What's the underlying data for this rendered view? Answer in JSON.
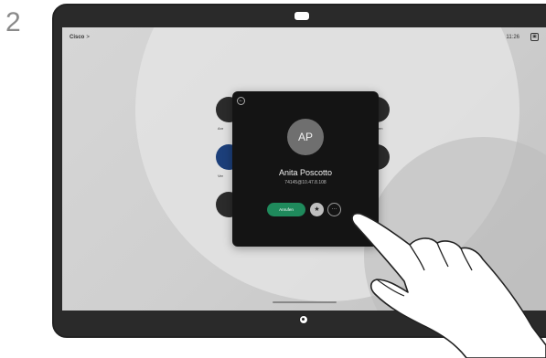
{
  "step": {
    "number": "2"
  },
  "header": {
    "brand": "Cisco",
    "chevron": ">",
    "time": "11:26"
  },
  "background_tiles": {
    "labels": [
      "Anr",
      "Ver",
      "en"
    ]
  },
  "contact_card": {
    "initials": "AP",
    "name": "Anita Poscotto",
    "address": "74145@10.47.8.108",
    "call_label": "Anrufen",
    "favorite_icon": "star-icon",
    "more_icon": "ellipsis-icon",
    "back_icon": "back-arrow-icon"
  },
  "colors": {
    "call_button": "#1f8a5c",
    "card_background": "#141414",
    "avatar": "#6f6f6f"
  }
}
